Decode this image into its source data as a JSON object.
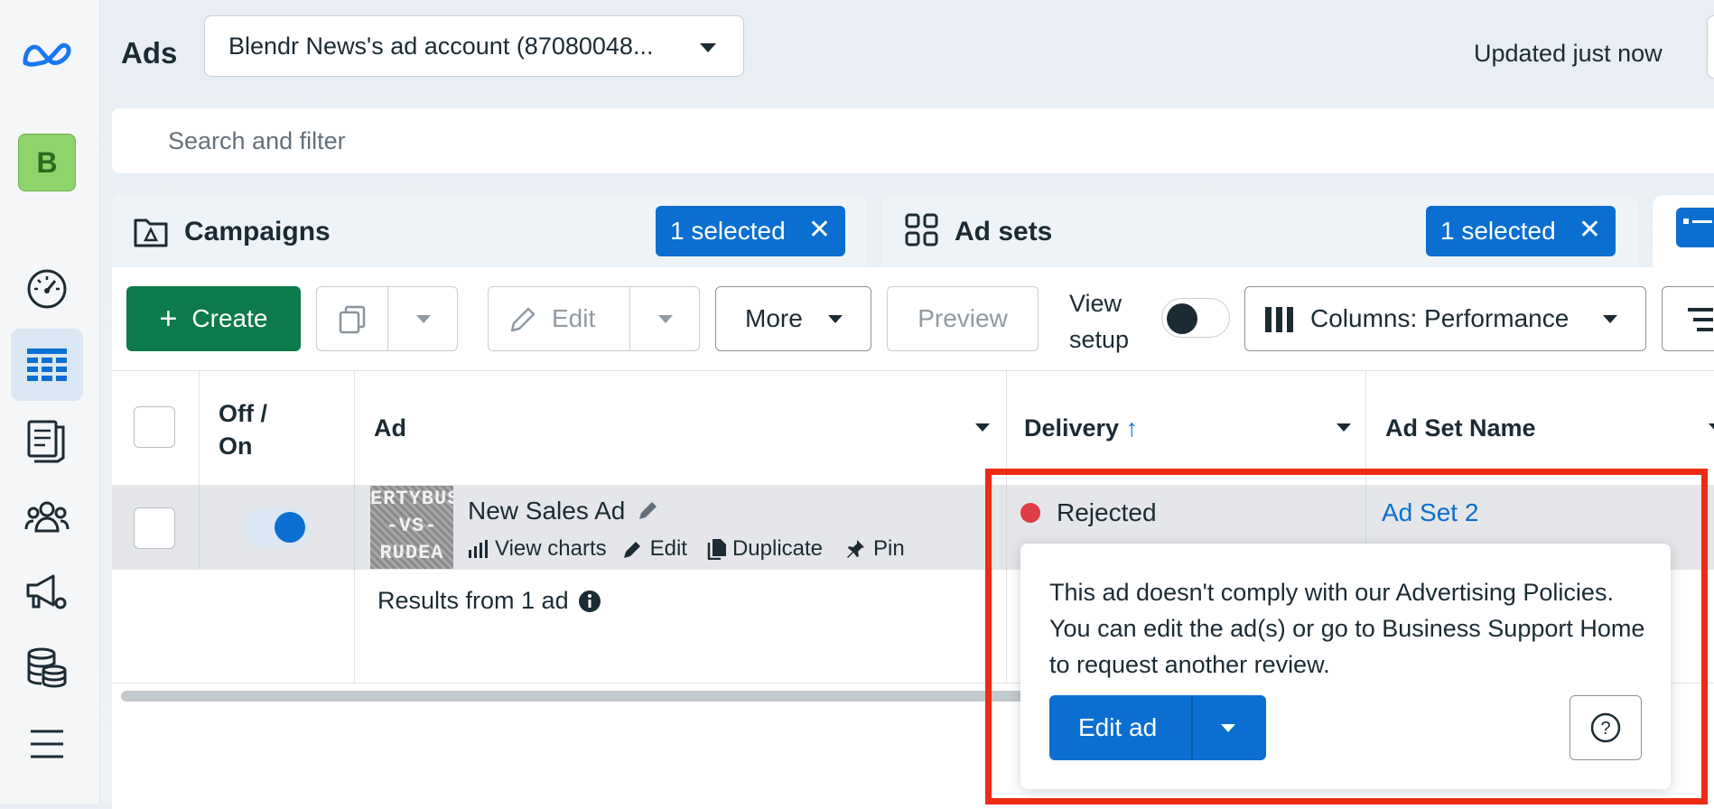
{
  "header": {
    "title": "Ads",
    "account_name": "Blendr News's ad account (87080048...",
    "updated_text": "Updated just now"
  },
  "rail": {
    "avatar_letter": "B",
    "icons": [
      "meta-logo-icon",
      "dashboard-icon",
      "ads-manager-table-icon",
      "pages-icon",
      "audiences-icon",
      "campaign-settings-icon",
      "billing-icon",
      "menu-icon"
    ]
  },
  "search": {
    "placeholder": "Search and filter"
  },
  "tabs": [
    {
      "label": "Campaigns",
      "selected": "1 selected"
    },
    {
      "label": "Ad sets",
      "selected": "1 selected"
    }
  ],
  "toolbar": {
    "create": "Create",
    "edit": "Edit",
    "more": "More",
    "preview": "Preview",
    "view_setup_line1": "View",
    "view_setup_line2": "setup",
    "columns": "Columns: Performance"
  },
  "table": {
    "headers": {
      "offon_line1": "Off /",
      "offon_line2": "On",
      "ad": "Ad",
      "delivery": "Delivery",
      "delivery_sort": "↑",
      "adset": "Ad Set Name"
    },
    "row": {
      "ad_name": "New Sales Ad",
      "actions": [
        "View charts",
        "Edit",
        "Duplicate",
        "Pin"
      ],
      "delivery_status": "Rejected",
      "adset_name": "Ad Set 2",
      "toggle_on": true,
      "thumb_lines": [
        "ERTYBUS",
        "-VS-",
        "RUDEA"
      ]
    },
    "results": "Results from 1 ad"
  },
  "popover": {
    "message": "This ad doesn't comply with our Advertising Policies. You can edit the ad(s) or go to Business Support Home to request another review.",
    "edit_ad": "Edit ad"
  },
  "colors": {
    "primary": "#0a6fd1",
    "create_green": "#0c7a4b",
    "rejected_red": "#e03c45",
    "highlight_red": "#ee2b14"
  }
}
